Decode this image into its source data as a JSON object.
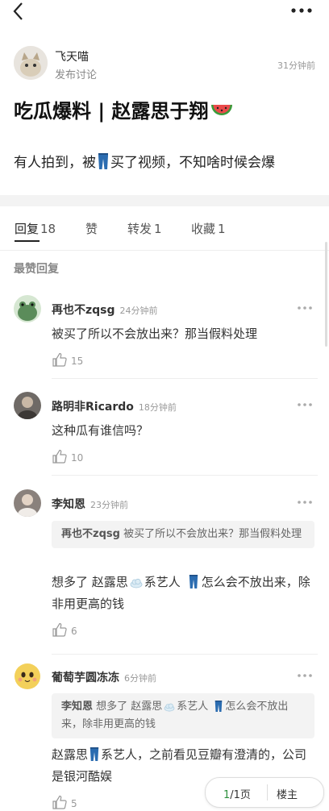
{
  "colors": {
    "accent_green": "#2c8f3c",
    "muted": "#999999",
    "divider": "#eeeeee"
  },
  "topbar": {
    "back_icon": "chevron-left-icon",
    "more_icon": "more-dots-icon"
  },
  "post": {
    "author_name": "飞天喵",
    "author_sub": "发布讨论",
    "time": "31分钟前",
    "title": "吃瓜爆料 | 赵露思于翔",
    "title_icon": "watermelon-icon",
    "body_part1": "有人拍到，被",
    "body_icon": "jeans-icon",
    "body_part2": "买了视频，不知啥时候会爆"
  },
  "tabs": [
    {
      "label": "回复",
      "count": "18"
    },
    {
      "label": "赞",
      "count": ""
    },
    {
      "label": "转发",
      "count": "1"
    },
    {
      "label": "收藏",
      "count": "1"
    }
  ],
  "section_title": "最赞回复",
  "comments": [
    {
      "name": "再也不zqsg",
      "time": "24分钟前",
      "text": "被买了所以不会放出来？那当假料处理",
      "likes": "15"
    },
    {
      "name": "路明非Ricardo",
      "time": "18分钟前",
      "text": "这种瓜有谁信吗？",
      "likes": "10"
    },
    {
      "name": "李知恩",
      "time": "23分钟前",
      "quote_name": "再也不zqsg",
      "quote_text": "被买了所以不会放出来？那当假料处理",
      "text_a": "想多了 赵露思",
      "text_b": "系艺人",
      "text_c": "怎么会不放出来，除非用更高的钱",
      "likes": "6"
    },
    {
      "name": "葡萄芋圆冻冻",
      "time": "6分钟前",
      "quote_name": "李知恩",
      "quote_a": "想多了 赵露思",
      "quote_b": "系艺人",
      "quote_c": "怎么会不放出来，除非用更高的钱",
      "text_a": "赵露思",
      "text_b": "系艺人，之前看见豆瓣有澄清的，公司是银河酷娱",
      "likes": "5"
    }
  ],
  "pager": {
    "current": "1",
    "rest": "/1页",
    "owner_label": "楼主"
  }
}
